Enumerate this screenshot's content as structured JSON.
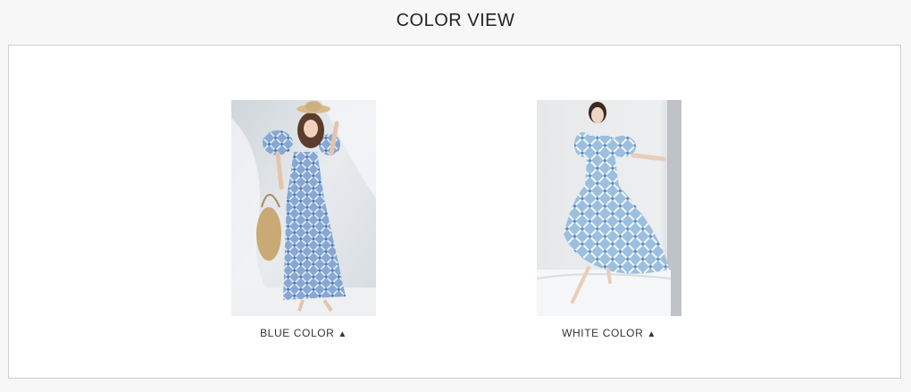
{
  "header": {
    "title": "COLOR VIEW"
  },
  "colors": {
    "dress": "#8fb0d6",
    "dress_pattern": "#e9f0f8",
    "backdrop": "#dfe3e7"
  },
  "products": [
    {
      "label": "BLUE COLOR",
      "arrow_icon": "triangle-up-icon",
      "arrow_glyph": "▲"
    },
    {
      "label": "WHITE COLOR",
      "arrow_icon": "triangle-up-icon",
      "arrow_glyph": "▲"
    }
  ]
}
